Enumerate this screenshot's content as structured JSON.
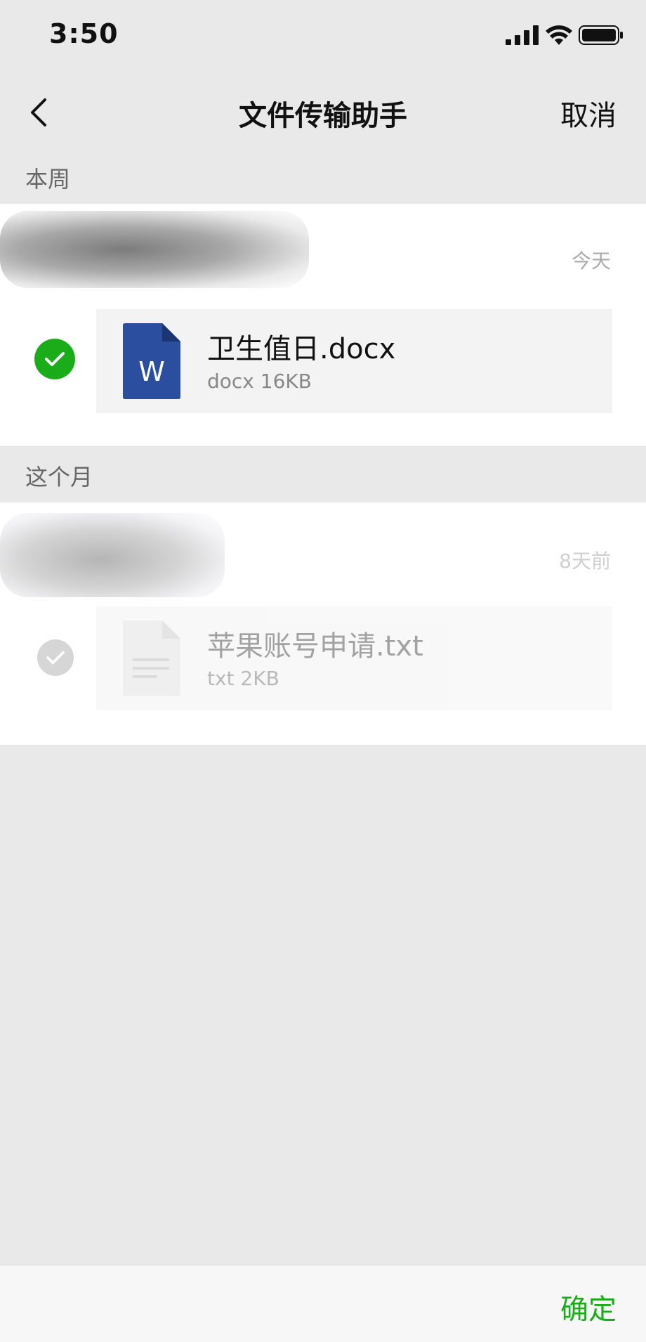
{
  "status_bar": {
    "time": "3:50"
  },
  "nav": {
    "title": "文件传输助手",
    "cancel_label": "取消"
  },
  "sections": [
    {
      "header": "本周",
      "time_label": "今天",
      "file": {
        "name": "卫生值日.docx",
        "meta": "docx 16KB",
        "type": "word",
        "checked": true
      }
    },
    {
      "header": "这个月",
      "time_label": "8天前",
      "file": {
        "name": "苹果账号申请.txt",
        "meta": "txt 2KB",
        "type": "text",
        "checked": false
      }
    }
  ],
  "bottom_bar": {
    "confirm_label": "确定"
  },
  "colors": {
    "accent_green": "#1aad19",
    "word_blue": "#2b4f9e",
    "background": "#e9e9e9"
  },
  "icons": [
    "back-chevron-icon",
    "signal-icon",
    "wifi-icon",
    "battery-icon",
    "check-icon",
    "word-file-icon",
    "text-file-icon"
  ]
}
